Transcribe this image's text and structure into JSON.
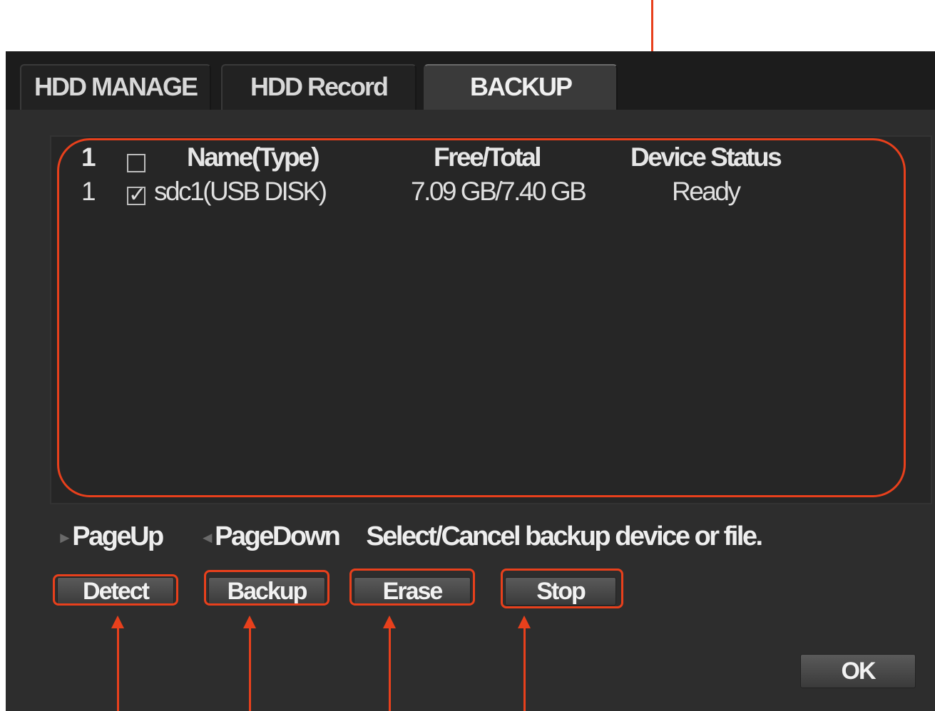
{
  "tabs": [
    {
      "label": "HDD MANAGE",
      "active": false
    },
    {
      "label": "HDD Record",
      "active": false
    },
    {
      "label": "BACKUP",
      "active": true
    }
  ],
  "table": {
    "headers": {
      "index": "1",
      "name": "Name(Type)",
      "free_total": "Free/Total",
      "status": "Device Status"
    },
    "rows": [
      {
        "index": "1",
        "checked": true,
        "name": "sdc1(USB DISK)",
        "free_total": "7.09 GB/7.40 GB",
        "status": "Ready"
      }
    ]
  },
  "paging": {
    "page_up": "PageUp",
    "page_down": "PageDown",
    "hint": "Select/Cancel backup device or file."
  },
  "buttons": {
    "detect": "Detect",
    "backup": "Backup",
    "erase": "Erase",
    "stop": "Stop",
    "ok": "OK"
  },
  "colors": {
    "annotation": "#e8401c",
    "panel_bg": "#2d2d2d"
  }
}
